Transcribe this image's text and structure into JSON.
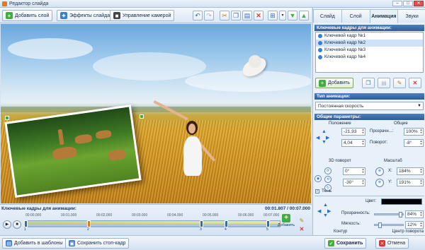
{
  "window": {
    "title": "Редактор слайда"
  },
  "toolbar": {
    "add_layer": "Добавить слой",
    "slide_effects": "Эффекты слайда",
    "camera_control": "Управление камерой"
  },
  "timeline": {
    "title": "Ключевые кадры для анимации:",
    "time_readout": "00:01.807 / 00:07.000",
    "ruler": [
      "00:00.000",
      "00:01.000",
      "00:02.000",
      "00:03.000",
      "00:04.000",
      "00:05.000",
      "00:06.000",
      "00:07.000"
    ],
    "keyframe_numbers": [
      "1",
      "2",
      "3",
      "4",
      "5"
    ],
    "add_label": "Добавить"
  },
  "bottom": {
    "add_to_templates": "Добавить в шаблоны",
    "save_stop_frame": "Сохранить стоп-кадр",
    "save": "Сохранить",
    "cancel": "Отмена"
  },
  "panel": {
    "tabs": [
      "Слайд",
      "Слой",
      "Анимация",
      "Звуки"
    ],
    "active_tab": "Анимация",
    "keyframes_header": "Ключевые кадры для анимации:",
    "keyframes": [
      "Ключевой кадр №1",
      "Ключевой кадр №2",
      "Ключевой кадр №3",
      "Ключевой кадр №4"
    ],
    "selected_keyframe_index": 1,
    "add_button": "Добавить",
    "anim_type_header": "Тип анимации:",
    "anim_type_value": "Постоянная скорость",
    "general_header": "Общие параметры:",
    "position_label": "Положение",
    "common_label": "Общие",
    "pos_x": "-21,93",
    "pos_y": "4,04",
    "opacity_label": "Прозрачн...:",
    "opacity_value": "100%",
    "rotate_label": "Поворот:",
    "rotate_value": "-8°",
    "rot3d_label": "3D поворот",
    "scale_label": "Масштаб",
    "rot3d_x": "0°",
    "rot3d_y": "-30°",
    "scale_x_label": "X:",
    "scale_x": "184%",
    "scale_y_label": "Y:",
    "scale_y": "191%",
    "shadow_label": "Тень",
    "color_label": "Цвет:",
    "shadow_color": "#000000",
    "shadow_opacity_label": "Прозрачность:",
    "shadow_opacity": "84%",
    "softness_label": "Мягкость:",
    "softness": "12%",
    "contour_label": "Контур",
    "rotation_center_label": "Центр поворота"
  },
  "colors": {
    "accent": "#2f5d98",
    "green": "#3fae3f",
    "red": "#d33a2f"
  }
}
